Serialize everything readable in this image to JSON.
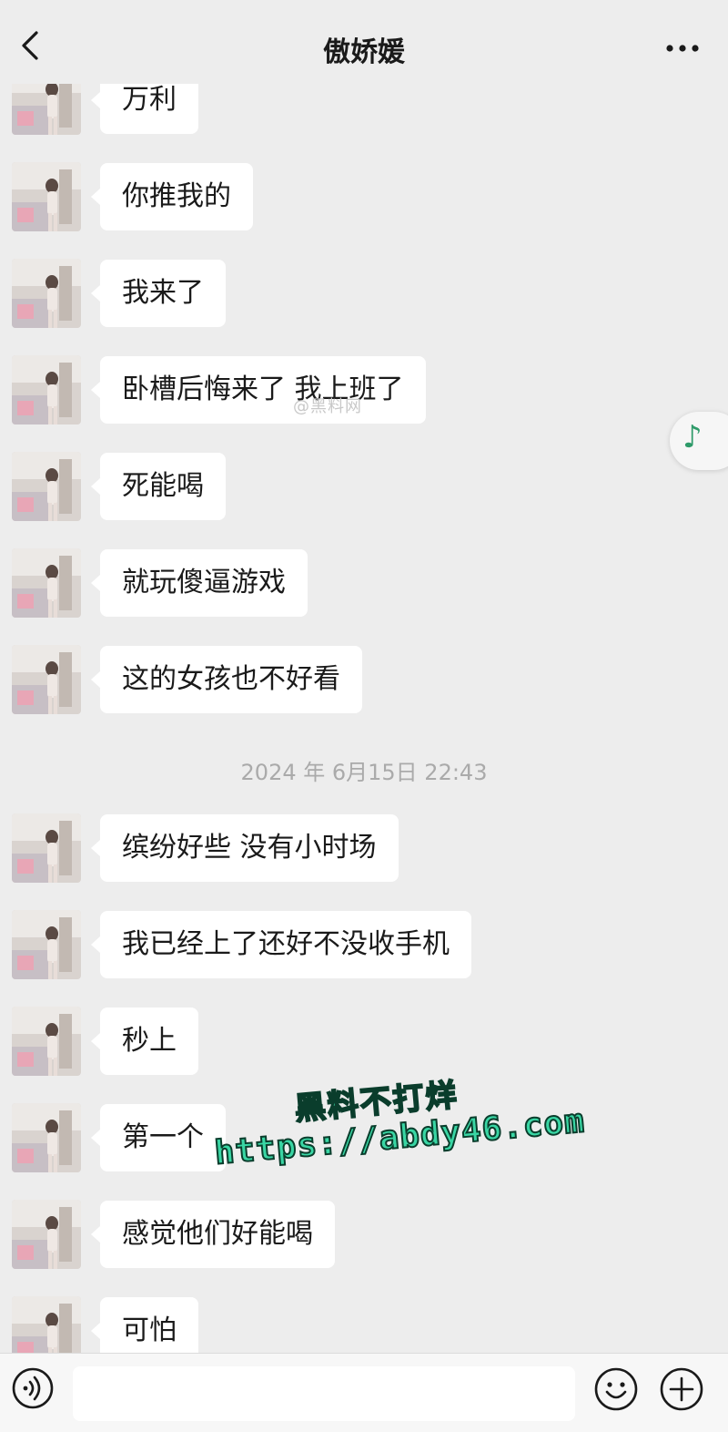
{
  "header": {
    "title": "傲娇媛",
    "back_icon": "chevron-left-icon",
    "more_icon": "more-horizontal-icon"
  },
  "messages": [
    {
      "text": "万利"
    },
    {
      "text": "你推我的"
    },
    {
      "text": "我来了"
    },
    {
      "text": "卧槽后悔来了 我上班了"
    },
    {
      "text": "死能喝"
    },
    {
      "text": "就玩傻逼游戏"
    },
    {
      "text": "这的女孩也不好看"
    },
    {
      "text": "缤纷好些 没有小时场"
    },
    {
      "text": "我已经上了还好不没收手机"
    },
    {
      "text": "秒上"
    },
    {
      "text": "第一个"
    },
    {
      "text": "感觉他们好能喝"
    },
    {
      "text": "可怕"
    }
  ],
  "timestamp": "2024 年 6月15日 22:43",
  "overlay": {
    "weibo_watermark": "@黑料网",
    "promo_line1": "黑料不打烊",
    "promo_line2": "https://abdy46.com",
    "music_icon": "music-note-icon"
  },
  "input_bar": {
    "voice_icon": "voice-icon",
    "input_value": "",
    "emoji_icon": "emoji-icon",
    "plus_icon": "plus-circle-icon"
  },
  "colors": {
    "background": "#ededed",
    "bubble": "#ffffff",
    "accent_green": "#2e9a69",
    "promo_green": "#39d6a4"
  }
}
